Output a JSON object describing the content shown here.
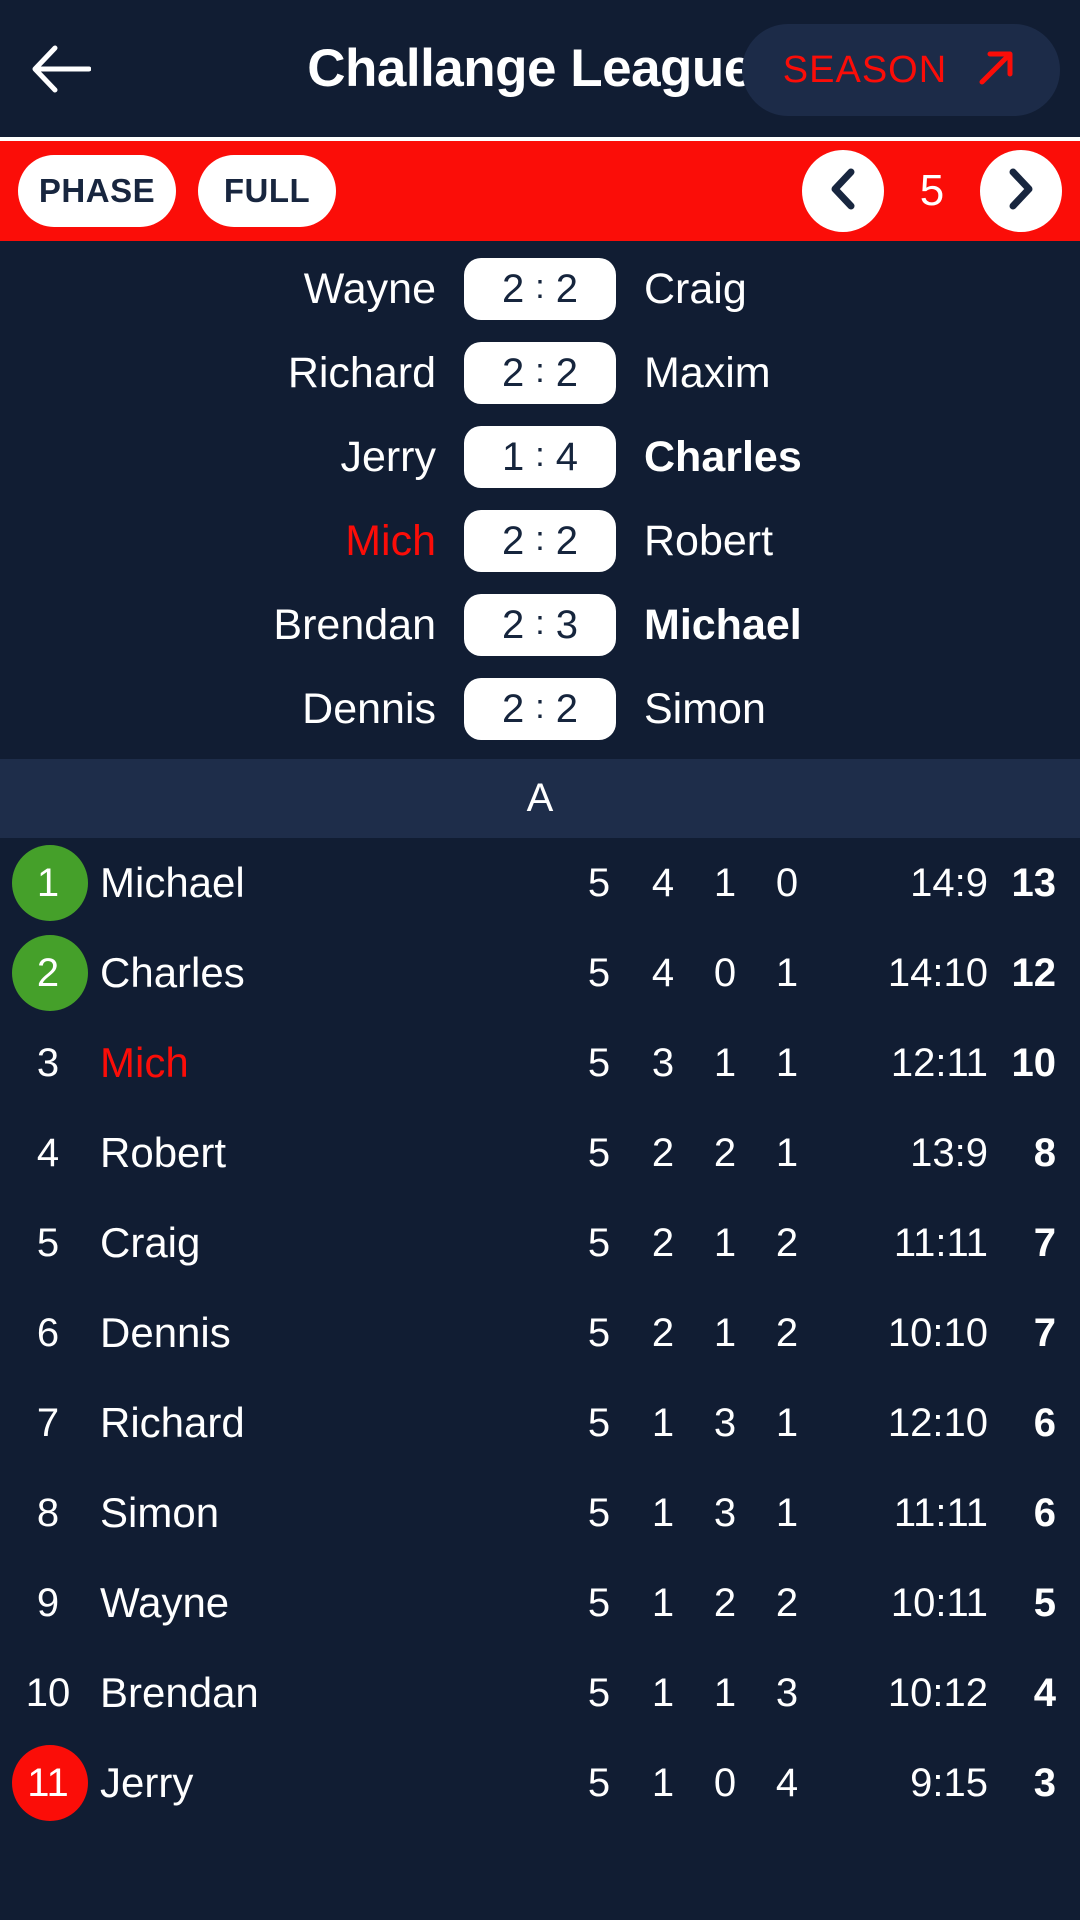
{
  "header": {
    "back_icon": "arrow-left-icon",
    "title": "Challange League",
    "season_label": "SEASON",
    "season_icon": "arrow-up-right-icon"
  },
  "toolbar": {
    "phase_label": "PHASE",
    "full_label": "FULL",
    "prev_icon": "chevron-left-icon",
    "next_icon": "chevron-right-icon",
    "round": "5"
  },
  "matches": [
    {
      "home": "Wayne",
      "home_score": "2",
      "away_score": "2",
      "away": "Craig",
      "home_state": "normal",
      "away_state": "normal"
    },
    {
      "home": "Richard",
      "home_score": "2",
      "away_score": "2",
      "away": "Maxim",
      "home_state": "normal",
      "away_state": "normal"
    },
    {
      "home": "Jerry",
      "home_score": "1",
      "away_score": "4",
      "away": "Charles",
      "home_state": "normal",
      "away_state": "win"
    },
    {
      "home": "Mich",
      "home_score": "2",
      "away_score": "2",
      "away": "Robert",
      "home_state": "me",
      "away_state": "normal"
    },
    {
      "home": "Brendan",
      "home_score": "2",
      "away_score": "3",
      "away": "Michael",
      "home_state": "normal",
      "away_state": "win"
    },
    {
      "home": "Dennis",
      "home_score": "2",
      "away_score": "2",
      "away": "Simon",
      "home_state": "normal",
      "away_state": "normal"
    }
  ],
  "group": {
    "label": "A"
  },
  "standings": [
    {
      "rank": "1",
      "name": "Michael",
      "played": "5",
      "wins": "4",
      "draws": "1",
      "losses": "0",
      "goals": "14:9",
      "points": "13",
      "badge": "green",
      "name_state": "normal"
    },
    {
      "rank": "2",
      "name": "Charles",
      "played": "5",
      "wins": "4",
      "draws": "0",
      "losses": "1",
      "goals": "14:10",
      "points": "12",
      "badge": "green",
      "name_state": "normal"
    },
    {
      "rank": "3",
      "name": "Mich",
      "played": "5",
      "wins": "3",
      "draws": "1",
      "losses": "1",
      "goals": "12:11",
      "points": "10",
      "badge": "none",
      "name_state": "me"
    },
    {
      "rank": "4",
      "name": "Robert",
      "played": "5",
      "wins": "2",
      "draws": "2",
      "losses": "1",
      "goals": "13:9",
      "points": "8",
      "badge": "none",
      "name_state": "normal"
    },
    {
      "rank": "5",
      "name": "Craig",
      "played": "5",
      "wins": "2",
      "draws": "1",
      "losses": "2",
      "goals": "11:11",
      "points": "7",
      "badge": "none",
      "name_state": "normal"
    },
    {
      "rank": "6",
      "name": "Dennis",
      "played": "5",
      "wins": "2",
      "draws": "1",
      "losses": "2",
      "goals": "10:10",
      "points": "7",
      "badge": "none",
      "name_state": "normal"
    },
    {
      "rank": "7",
      "name": "Richard",
      "played": "5",
      "wins": "1",
      "draws": "3",
      "losses": "1",
      "goals": "12:10",
      "points": "6",
      "badge": "none",
      "name_state": "normal"
    },
    {
      "rank": "8",
      "name": "Simon",
      "played": "5",
      "wins": "1",
      "draws": "3",
      "losses": "1",
      "goals": "11:11",
      "points": "6",
      "badge": "none",
      "name_state": "normal"
    },
    {
      "rank": "9",
      "name": "Wayne",
      "played": "5",
      "wins": "1",
      "draws": "2",
      "losses": "2",
      "goals": "10:11",
      "points": "5",
      "badge": "none",
      "name_state": "normal"
    },
    {
      "rank": "10",
      "name": "Brendan",
      "played": "5",
      "wins": "1",
      "draws": "1",
      "losses": "3",
      "goals": "10:12",
      "points": "4",
      "badge": "none",
      "name_state": "normal"
    },
    {
      "rank": "11",
      "name": "Jerry",
      "played": "5",
      "wins": "1",
      "draws": "0",
      "losses": "4",
      "goals": "9:15",
      "points": "3",
      "badge": "red",
      "name_state": "normal"
    }
  ],
  "colors": {
    "background": "#111d33",
    "accent_red": "#fb0d08",
    "band": "#1e2d4a",
    "badge_green": "#45a02a",
    "badge_red": "#fb0d08",
    "pill_white": "#ffffff"
  }
}
